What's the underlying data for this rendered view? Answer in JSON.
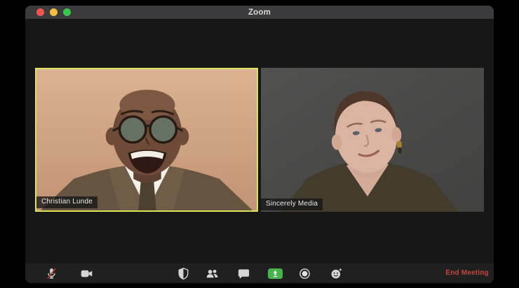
{
  "window": {
    "title": "Zoom",
    "traffic_lights": [
      "close",
      "minimize",
      "fullscreen"
    ]
  },
  "video_grid": {
    "tiles": [
      {
        "name_label": "Christian Lunde",
        "active_speaker": true,
        "portrait": "laughing-man-glasses-tweed-jacket-on-tan-background"
      },
      {
        "name_label": "Sincerely Media",
        "active_speaker": false,
        "portrait": "woman-short-hair-olive-top-on-gray-background"
      }
    ]
  },
  "toolbar": {
    "icons": [
      {
        "name": "microphone-muted-icon",
        "state": "muted"
      },
      {
        "name": "video-camera-icon",
        "state": "on"
      },
      {
        "name": "security-shield-icon"
      },
      {
        "name": "participants-icon"
      },
      {
        "name": "chat-icon"
      },
      {
        "name": "share-screen-icon"
      },
      {
        "name": "record-icon"
      },
      {
        "name": "reactions-icon"
      }
    ],
    "end_meeting_label": "End Meeting"
  },
  "colors": {
    "window_bg": "#171717",
    "titlebar_bg": "#3b3b3d",
    "toolbar_bg": "#202021",
    "active_speaker_border": "#d9e35c",
    "share_green": "#45b54a",
    "end_meeting_red": "#c9453e",
    "traffic_red": "#f3564e",
    "traffic_yellow": "#f5bd3f",
    "traffic_green": "#3ac54d",
    "icon_color": "#d8d4d2",
    "mute_slash_red": "#b5362e",
    "label_bg": "rgba(22,22,22,0.78)"
  }
}
